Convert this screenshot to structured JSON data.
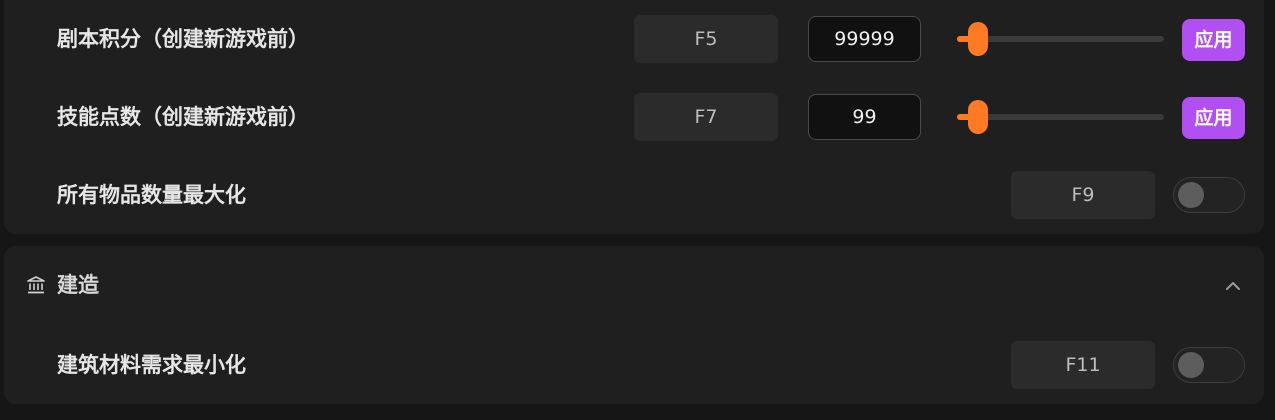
{
  "colors": {
    "accent_orange": "#ff7a22",
    "apply_purple": "#b14ff2",
    "panel_bg": "#1f1f1f",
    "page_bg": "#161616"
  },
  "cheats": {
    "rows": [
      {
        "label": "剧本积分（创建新游戏前）",
        "hotkey": "F5",
        "value": "99999",
        "slider_fraction": 0.1,
        "apply_label": "应用"
      },
      {
        "label": "技能点数（创建新游戏前）",
        "hotkey": "F7",
        "value": "99",
        "slider_fraction": 0.1,
        "apply_label": "应用"
      },
      {
        "label": "所有物品数量最大化",
        "hotkey": "F9",
        "toggle_on": false
      }
    ]
  },
  "build": {
    "title": "建造",
    "icon": "building-icon",
    "collapse_icon": "chevron-up-icon",
    "rows": [
      {
        "label": "建筑材料需求最小化",
        "hotkey": "F11",
        "toggle_on": false
      }
    ]
  }
}
